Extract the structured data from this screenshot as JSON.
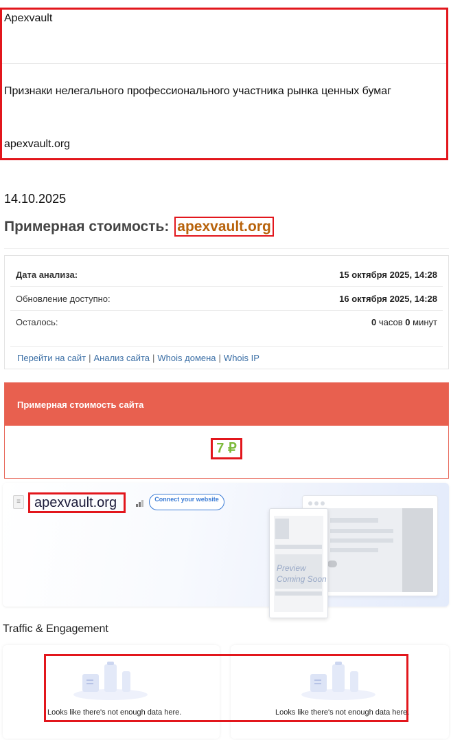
{
  "top": {
    "brand": "Apexvault",
    "warning": "Признаки нелегального профессионального участника рынка ценных бумаг",
    "domain": "apexvault.org"
  },
  "date": "14.10.2025",
  "heading": {
    "prefix": "Примерная стоимость:",
    "domain": "apexvault.org"
  },
  "info": {
    "rows": [
      {
        "label": "Дата анализа:",
        "value": "15 октября 2025, 14:28"
      },
      {
        "label": "Обновление доступно:",
        "value": "16 октября 2025, 14:28"
      }
    ],
    "remaining": {
      "label": "Осталось:",
      "hours": "0",
      "hours_unit": "часов",
      "minutes": "0",
      "minutes_unit": "минут"
    },
    "links": [
      "Перейти на сайт",
      "Анализ сайта",
      "Whois домена",
      "Whois IP"
    ]
  },
  "estimate": {
    "title": "Примерная стоимость сайта",
    "value": "7 ₽"
  },
  "banner": {
    "domain": "apexvault.org",
    "connect_label": "Connect your website",
    "preview_line1": "Preview",
    "preview_line2": "Coming Soon"
  },
  "traffic": {
    "title": "Traffic & Engagement",
    "empty_left": "Looks like there's not enough data here.",
    "empty_right": "Looks like there's not enough data here."
  },
  "colors": {
    "highlight_red": "#e2161c",
    "heading_domain": "#b8630b",
    "estimate_header": "#e8604f",
    "estimate_value": "#7cba3b",
    "link": "#3a6ea5",
    "connect_button": "#3a7bd5"
  }
}
